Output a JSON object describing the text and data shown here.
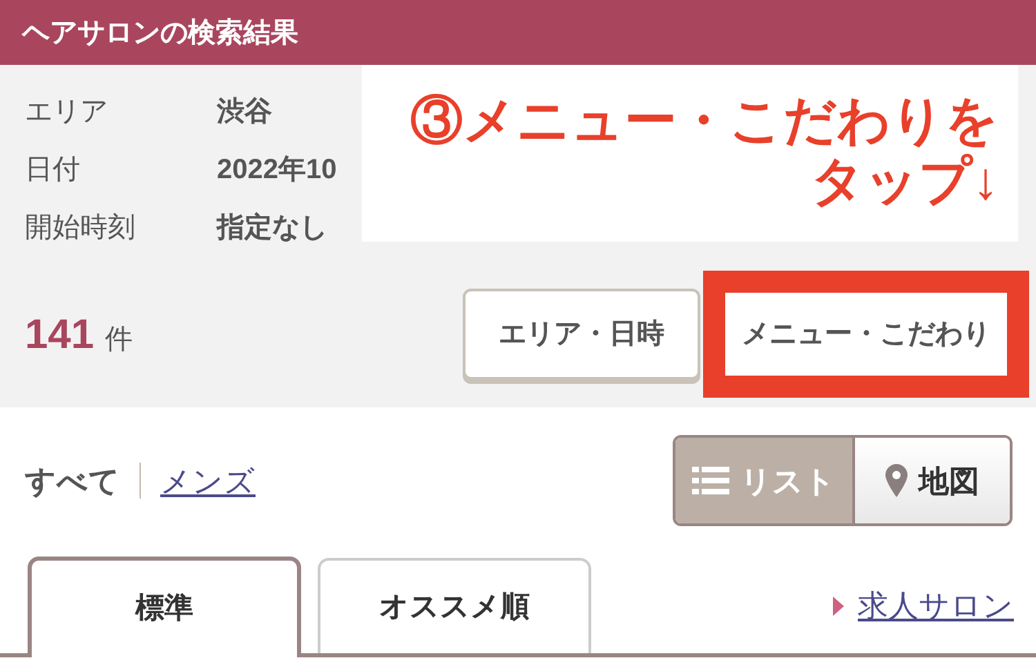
{
  "header": {
    "title": "ヘアサロンの検索結果"
  },
  "conditions": [
    {
      "label": "エリア",
      "value": "渋谷"
    },
    {
      "label": "日付",
      "value": "2022年10"
    },
    {
      "label": "開始時刻",
      "value": "指定なし"
    }
  ],
  "result_count": {
    "count": "141",
    "unit": "件"
  },
  "buttons": [
    {
      "label": "エリア・日時",
      "highlighted": false
    },
    {
      "label": "メニュー・こだわり",
      "highlighted": true
    }
  ],
  "filters": [
    {
      "label": "すべて",
      "selected": true
    },
    {
      "label": "メンズ",
      "selected": false
    }
  ],
  "view_toggle": [
    {
      "label": "リスト",
      "kind": "list",
      "selected": true
    },
    {
      "label": "地図",
      "kind": "map",
      "selected": false
    }
  ],
  "sort_tabs": [
    {
      "label": "標準",
      "selected": true
    },
    {
      "label": "オススメ順",
      "selected": false
    }
  ],
  "link": "求人サロン",
  "annotation": {
    "lines": [
      "③メニュー・こだわりを",
      "タップ↓"
    ]
  }
}
